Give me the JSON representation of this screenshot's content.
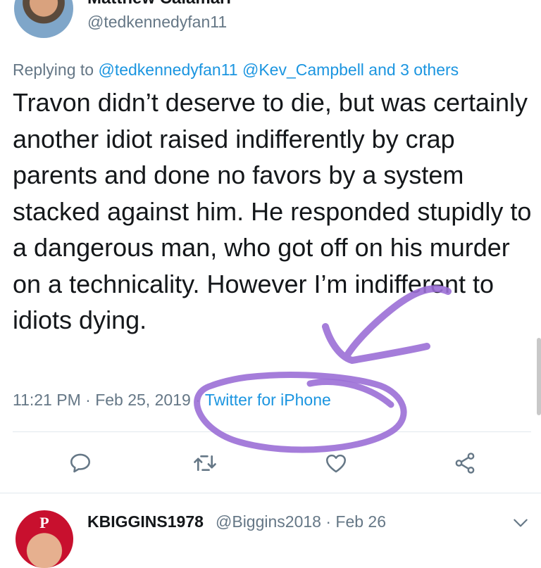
{
  "original_tweet": {
    "author_name": "Matthew Calamari",
    "handle": "@tedkennedyfan11",
    "avatar_icon": "profile-photo"
  },
  "reply_context": {
    "prefix": "Replying to",
    "mentions": "@tedkennedyfan11 @Kev_Campbell and 3 others"
  },
  "tweet": {
    "text": "Travon didn’t deserve to die, but was certainly another idiot raised indifferently by crap parents and done no favors by a system stacked against him. He responded stupidly to a dangerous man, who got off on his murder on a technicality. However I’m indifferent to idiots dying.",
    "time": "11:21 PM",
    "date": "Feb 25, 2019",
    "separator": "·",
    "source": "Twitter for iPhone"
  },
  "actions": {
    "reply_icon": "reply-icon",
    "retweet_icon": "retweet-icon",
    "like_icon": "like-icon",
    "share_icon": "share-icon"
  },
  "next_reply": {
    "name": "KBIGGINS1978",
    "handle": "@Biggins2018",
    "date": "Feb 26",
    "avatar_letter": "P",
    "menu_icon": "chevron-down-icon"
  },
  "colors": {
    "text": "#14171a",
    "secondary": "#657786",
    "link": "#1b95e0",
    "annotation": "#9b6fd6"
  }
}
